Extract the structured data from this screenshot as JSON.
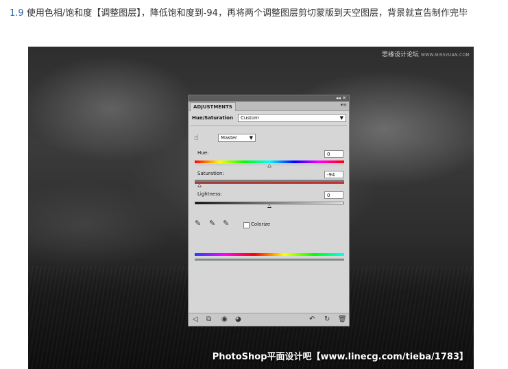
{
  "caption": {
    "step": "1.9",
    "text": "使用色相/饱和度【调整图层】，降低饱和度到-94，再将两个调整图层剪切蒙版到天空图层，背景就宣告制作完毕"
  },
  "photo": {
    "watermark_top": "思缘设计论坛",
    "watermark_top_url": "WWW.MISSYUAN.COM",
    "watermark_bottom": "PhotoShop平面设计吧【www.linecg.com/tieba/1783】"
  },
  "panel": {
    "title_controls": "◂◂ ✕",
    "tab": "ADJUSTMENTS",
    "menu_icon": "▾≡",
    "adjustment_name": "Hue/Saturation",
    "preset": {
      "value": "Custom"
    },
    "channel": {
      "value": "Master"
    },
    "hue": {
      "label": "Hue:",
      "value": "0",
      "fraction": 0.5
    },
    "saturation": {
      "label": "Saturation:",
      "value": "-94",
      "fraction": 0.03
    },
    "lightness": {
      "label": "Lightness:",
      "value": "0",
      "fraction": 0.5
    },
    "colorize": {
      "label": "Colorize",
      "checked": false
    },
    "icons": {
      "hand_tool": "hand-adjust-icon",
      "eyedropper": "eyedropper-icon",
      "eyedropper_add": "eyedropper-plus-icon",
      "eyedropper_subtract": "eyedropper-minus-icon",
      "footer": [
        "back-arrow-icon",
        "clip-layer-icon",
        "visibility-icon",
        "view-previous-icon",
        "previous-state-icon",
        "reset-icon",
        "trash-icon"
      ]
    }
  }
}
